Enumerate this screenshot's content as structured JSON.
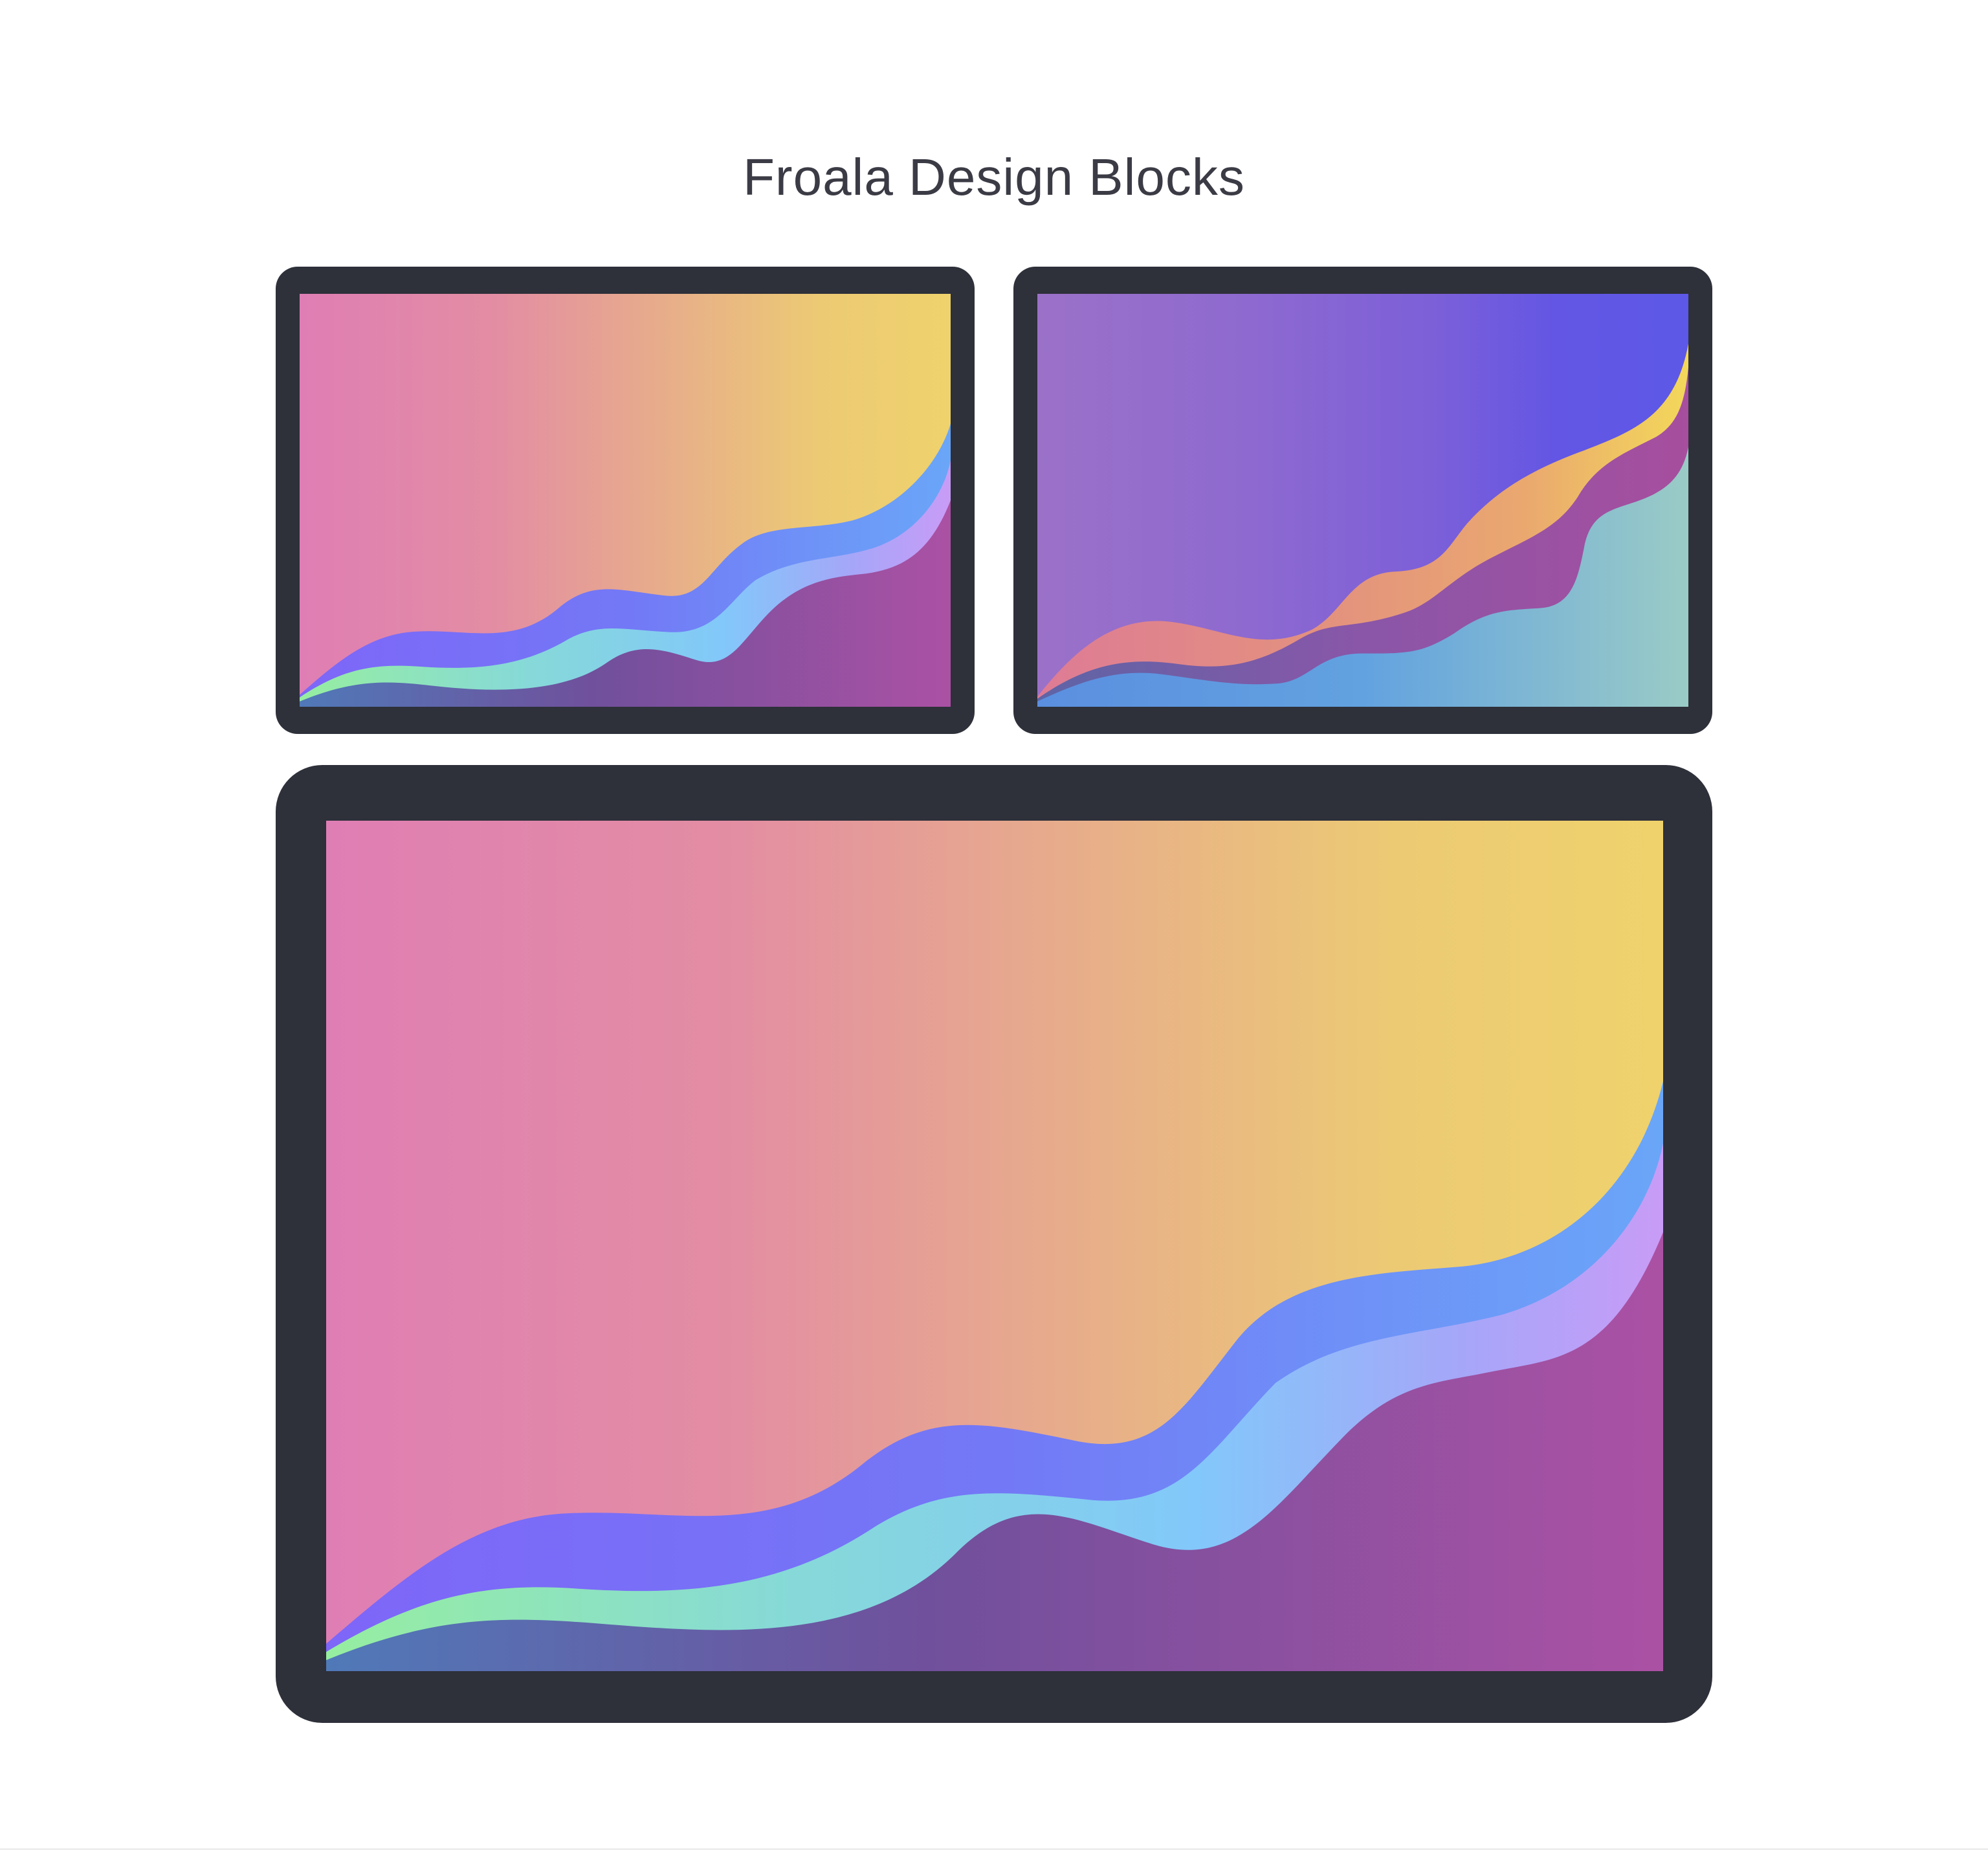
{
  "page": {
    "title": "Froala Design Blocks"
  },
  "cards": {
    "top_left": {
      "frame_color": "#2e303a",
      "sky_colors": [
        "#df7eb4",
        "#e3919f",
        "#e8b385",
        "#eccd72",
        "#efd26c"
      ],
      "wave_colors": [
        "#7b6cf7",
        "#6fa2f8",
        "#86d6ef",
        "#96eea0",
        "#c89df7",
        "#5a7ab8",
        "#a852a4"
      ]
    },
    "top_right": {
      "frame_color": "#2e303a",
      "sky_colors": [
        "#9b71c8",
        "#8f69d0",
        "#7b60d8",
        "#5d58e7"
      ],
      "wave_colors": [
        "#e07c90",
        "#eaa472",
        "#f2d35c",
        "#9a4ea0",
        "#5d8ede",
        "#6ab0dd",
        "#97cbc8"
      ]
    },
    "bottom": {
      "frame_color": "#2e303a",
      "sky_colors": [
        "#df7eb4",
        "#e3919f",
        "#e8b385",
        "#eccd72",
        "#efd26c"
      ],
      "wave_colors": [
        "#7b6cf7",
        "#6fa2f8",
        "#86d6ef",
        "#96eea0",
        "#c89df7",
        "#5a7ab8",
        "#a852a4"
      ]
    }
  }
}
